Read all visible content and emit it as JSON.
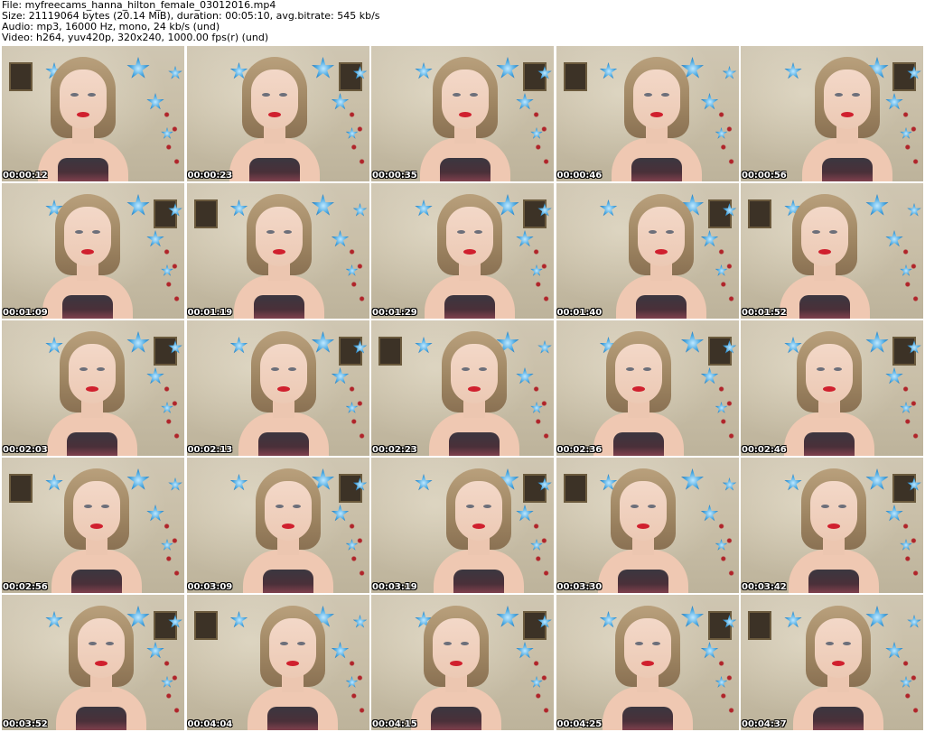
{
  "header": {
    "file_line": "File: myfreecams_hanna_hilton_female_03012016.mp4",
    "size_line": "Size: 21119064 bytes (20.14 MiB), duration: 00:05:10, avg.bitrate: 545 kb/s",
    "audio_line": "Audio: mp3, 16000 Hz, mono, 24 kb/s (und)",
    "video_line": "Video: h264, yuv420p, 320x240, 1000.00 fps(r) (und)"
  },
  "thumbnails": [
    {
      "time": "00:00:12"
    },
    {
      "time": "00:00:23"
    },
    {
      "time": "00:00:35"
    },
    {
      "time": "00:00:46"
    },
    {
      "time": "00:00:56"
    },
    {
      "time": "00:01:09"
    },
    {
      "time": "00:01:19"
    },
    {
      "time": "00:01:29"
    },
    {
      "time": "00:01:40"
    },
    {
      "time": "00:01:52"
    },
    {
      "time": "00:02:03"
    },
    {
      "time": "00:02:13"
    },
    {
      "time": "00:02:23"
    },
    {
      "time": "00:02:36"
    },
    {
      "time": "00:02:46"
    },
    {
      "time": "00:02:56"
    },
    {
      "time": "00:03:09"
    },
    {
      "time": "00:03:19"
    },
    {
      "time": "00:03:30"
    },
    {
      "time": "00:03:42"
    },
    {
      "time": "00:03:52"
    },
    {
      "time": "00:04:04"
    },
    {
      "time": "00:04:15"
    },
    {
      "time": "00:04:25"
    },
    {
      "time": "00:04:37"
    }
  ]
}
